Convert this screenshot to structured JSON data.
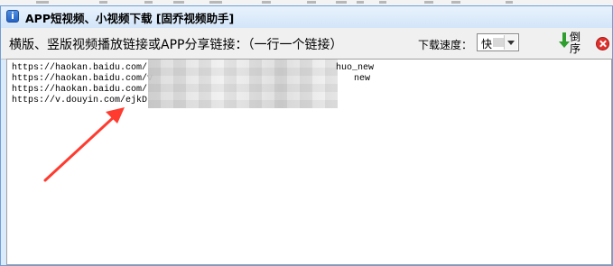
{
  "window": {
    "title": "APP短视频、小视频下载 [固乔视频助手]"
  },
  "toolbar": {
    "prompt": "横版、竖版视频播放链接或APP分享链接：（一行一个链接）",
    "speed_label": "下载速度：",
    "speed_value": "快",
    "sort_label": "倒序",
    "sort_icon": "green-down-arrow-icon",
    "close_icon": "red-close-icon"
  },
  "editor": {
    "lines": [
      "https://haokan.baidu.com/",
      "https://haokan.baidu.com/v",
      "https://haokan.baidu.com/",
      "https://v.douyin.com/ejkD"
    ],
    "line_suffixes": [
      "huo_new",
      "new"
    ]
  },
  "colors": {
    "title_bg": "#dcebfb",
    "toolbar_bg": "#f0f0f0",
    "annotation_arrow": "#ff3b2f",
    "sort_arrow": "#2e9e2e",
    "close": "#e0302c"
  }
}
